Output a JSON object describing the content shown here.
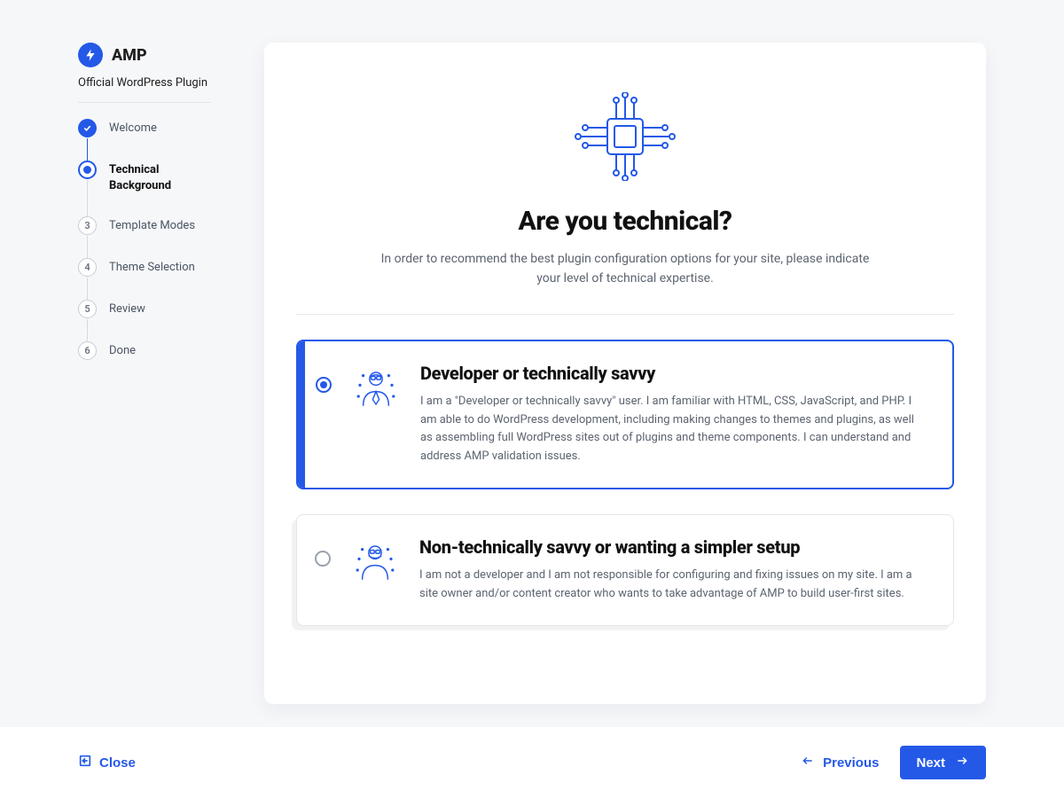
{
  "brand": {
    "name": "AMP",
    "subtitle": "Official WordPress Plugin"
  },
  "steps": [
    {
      "num": "1",
      "label": "Welcome",
      "state": "completed"
    },
    {
      "num": "2",
      "label": "Technical Background",
      "state": "current"
    },
    {
      "num": "3",
      "label": "Template Modes",
      "state": "pending"
    },
    {
      "num": "4",
      "label": "Theme Selection",
      "state": "pending"
    },
    {
      "num": "5",
      "label": "Review",
      "state": "pending"
    },
    {
      "num": "6",
      "label": "Done",
      "state": "pending"
    }
  ],
  "hero": {
    "title": "Are you technical?",
    "desc": "In order to recommend the best plugin configuration options for your site, please indicate your level of technical expertise."
  },
  "options": [
    {
      "id": "developer",
      "selected": true,
      "title": "Developer or technically savvy",
      "desc": "I am a \"Developer or technically savvy\" user. I am familiar with HTML, CSS, JavaScript, and PHP. I am able to do WordPress development, including making changes to themes and plugins, as well as assembling full WordPress sites out of plugins and theme components. I can understand and address AMP validation issues."
    },
    {
      "id": "nontechnical",
      "selected": false,
      "title": "Non-technically savvy or wanting a simpler setup",
      "desc": "I am not a developer and I am not responsible for configuring and fixing issues on my site. I am a site owner and/or content creator who wants to take advantage of AMP to build user-first sites."
    }
  ],
  "footer": {
    "close": "Close",
    "previous": "Previous",
    "next": "Next"
  }
}
